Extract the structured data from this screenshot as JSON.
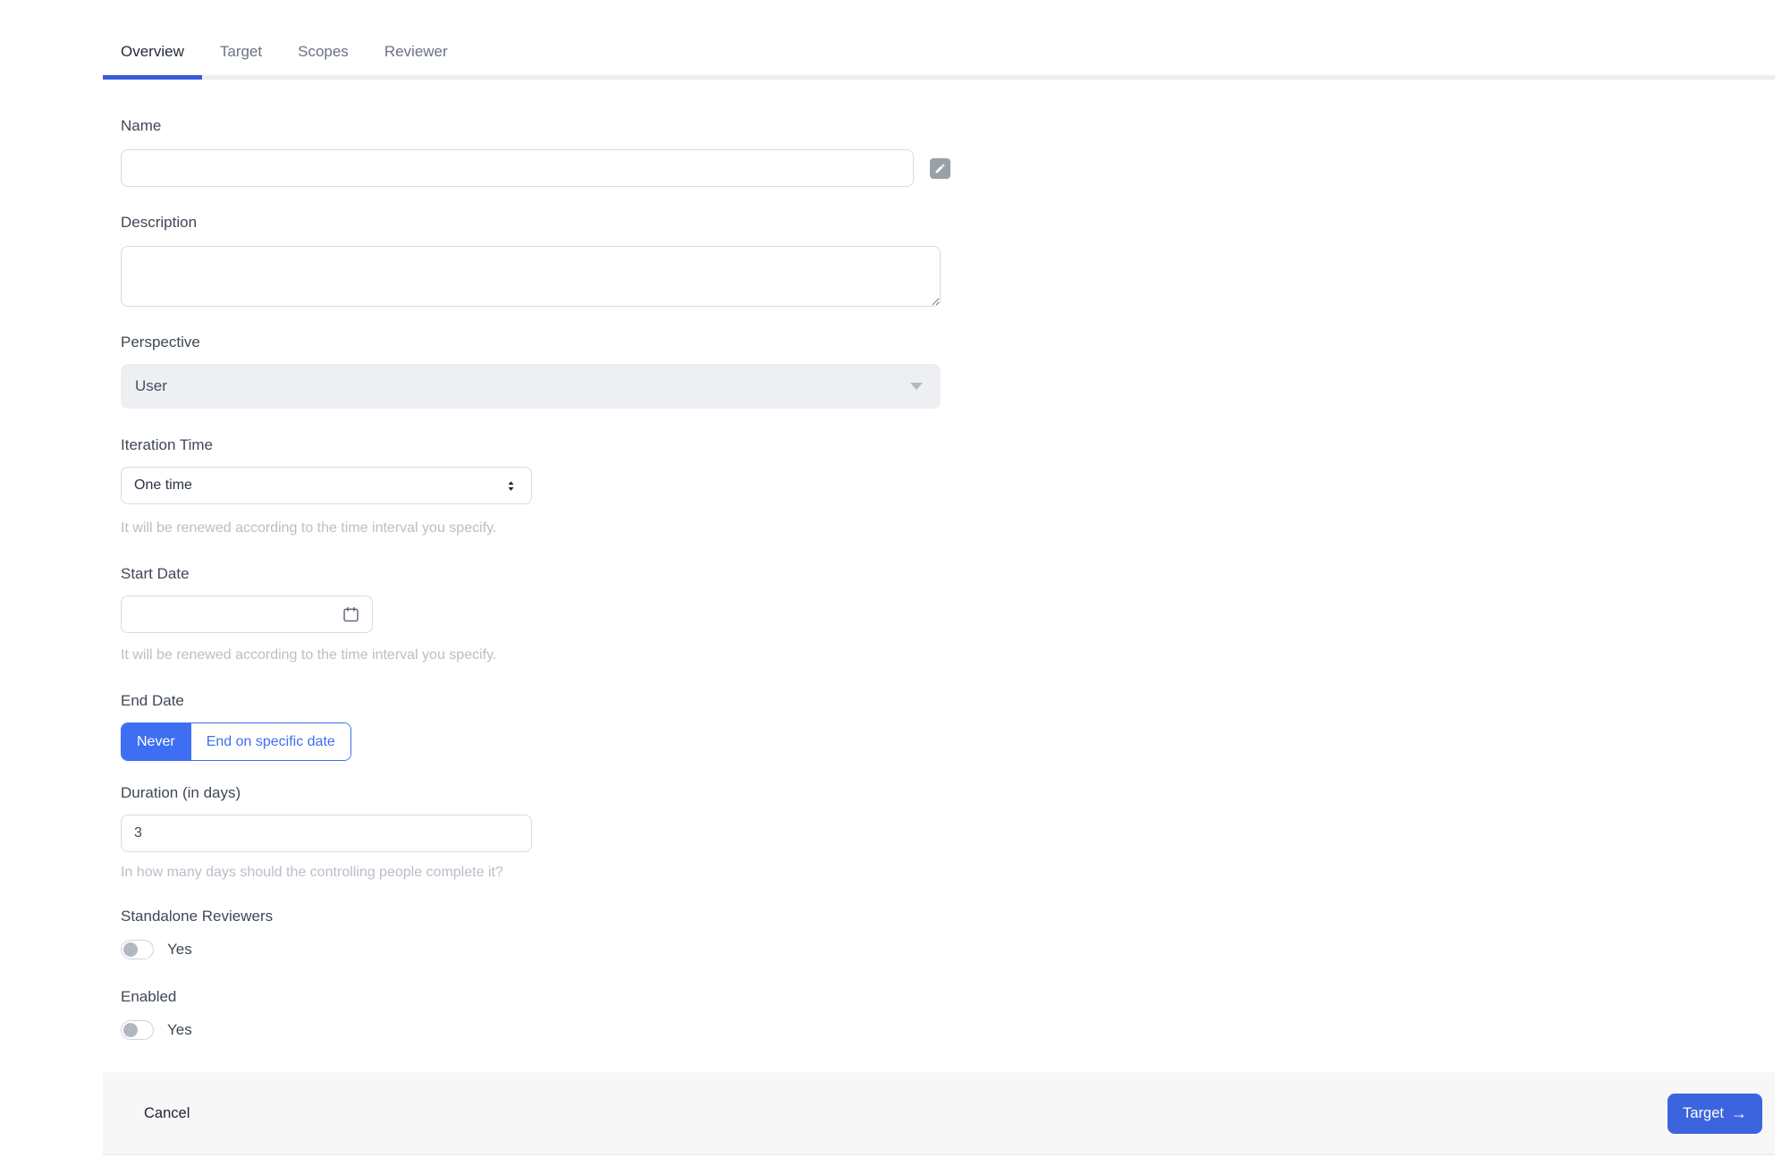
{
  "colors": {
    "accent": "#3c64de",
    "accent_bright": "#3e6ff2",
    "tab_underline": "#3a5cd8",
    "footer_bg": "#f7f7f8",
    "helper_text": "#b9bec8",
    "label_text": "#3f4856",
    "border": "#d9dcdf",
    "disabled_bg": "#edeff2",
    "toggle_knob": "#b2b8c2"
  },
  "tabs": [
    {
      "label": "Overview",
      "active": true
    },
    {
      "label": "Target",
      "active": false
    },
    {
      "label": "Scopes",
      "active": false
    },
    {
      "label": "Reviewer",
      "active": false
    }
  ],
  "form": {
    "name": {
      "label": "Name",
      "value": ""
    },
    "description": {
      "label": "Description",
      "value": ""
    },
    "perspective": {
      "label": "Perspective",
      "value": "User"
    },
    "iteration_time": {
      "label": "Iteration Time",
      "value": "One time",
      "helper": "It will be renewed according to the time interval you specify."
    },
    "start_date": {
      "label": "Start Date",
      "value": "",
      "helper": "It will be renewed according to the time interval you specify."
    },
    "end_date": {
      "label": "End Date",
      "options": [
        {
          "label": "Never",
          "selected": true
        },
        {
          "label": "End on specific date",
          "selected": false
        }
      ]
    },
    "duration": {
      "label": "Duration (in days)",
      "value": "3",
      "helper": "In how many days should the controlling people complete it?"
    },
    "standalone_reviewers": {
      "label": "Standalone Reviewers",
      "toggle_label": "Yes",
      "on": false
    },
    "enabled": {
      "label": "Enabled",
      "toggle_label": "Yes",
      "on": false
    }
  },
  "footer": {
    "cancel_label": "Cancel",
    "next_label": "Target",
    "next_arrow": "→"
  },
  "icons": {
    "edit": "pencil-icon",
    "dropdown": "chevron-down-icon",
    "iteration_select": "up-down-arrows-icon",
    "start_date": "calendar-icon",
    "next_button": "arrow-right-icon"
  }
}
